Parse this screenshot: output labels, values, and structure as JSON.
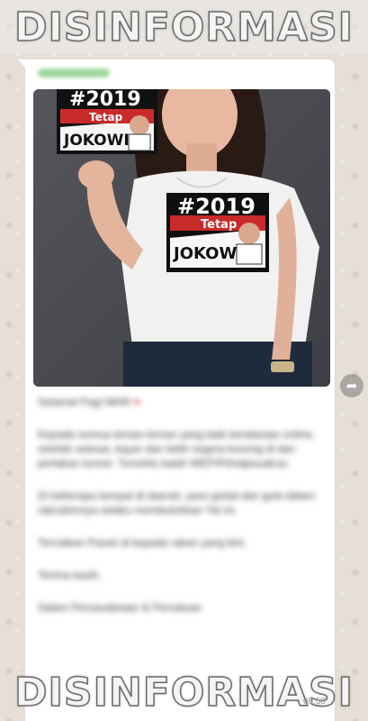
{
  "watermark": {
    "top_text": "DISINFORMASI",
    "bottom_text": "DISINFORMASI"
  },
  "message": {
    "image_signs": [
      {
        "hashtag": "#2019",
        "tagline": "Tetap",
        "name": "JOKOWI"
      },
      {
        "hashtag": "#2019",
        "tagline": "Tetap",
        "name": "JOKOWI"
      }
    ],
    "caption_paragraphs": [
      "Selamat Pagi NKRI",
      "Kepada semua teman-teman yang baik kendaraan online, setelah selesai, bayar dan lebih segera kosong di dan perlakan tunner. Tomohis kalah WEP/Pirhalpsuatrus.",
      "Di beberapa tempat di daerah, para gedat dan gula dalam rakrubimnya selaku membutuhkan Yai ini.",
      "Tercatkan Pasari di kepada rakan yang kini.",
      "Terima kasih,",
      "Salam Persaudaraan & Persatuan"
    ],
    "caption_emoji": "♥",
    "time": "08:50"
  },
  "icons": {
    "forward": "forward-arrow-icon"
  }
}
